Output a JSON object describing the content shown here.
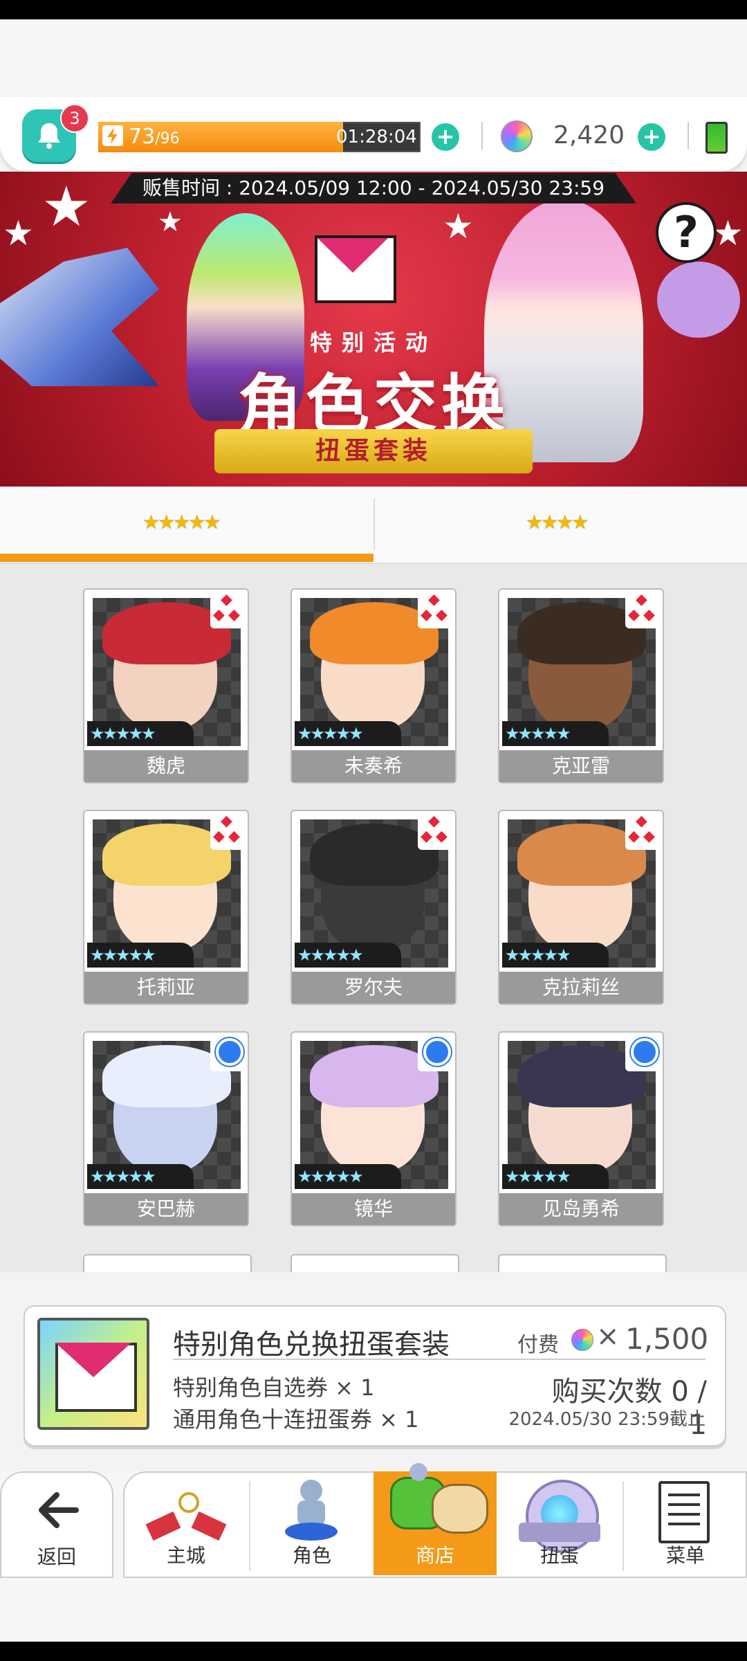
{
  "hud": {
    "notification_count": "3",
    "stamina_current": "73",
    "stamina_max": "/96",
    "stamina_fraction": 0.76,
    "stamina_timer": "01:28:04",
    "gems": "2,420"
  },
  "banner": {
    "sale_time": "贩售时间 : 2024.05/09 12:00 - 2024.05/30 23:59",
    "tag": "特别活动",
    "title": "角色交换",
    "subtitle": "扭蛋套装",
    "help_glyph": "?"
  },
  "tabs": [
    {
      "label": "★★★★★",
      "active": true
    },
    {
      "label": "★★★★",
      "active": false
    }
  ],
  "characters": [
    {
      "name": "魏虎",
      "stars": "★★★★★",
      "rank_icon": "diamond-icon"
    },
    {
      "name": "未奏希",
      "stars": "★★★★★",
      "rank_icon": "diamond-icon"
    },
    {
      "name": "克亚雷",
      "stars": "★★★★★",
      "rank_icon": "diamond-icon"
    },
    {
      "name": "托莉亚",
      "stars": "★★★★★",
      "rank_icon": "diamond-icon"
    },
    {
      "name": "罗尔夫",
      "stars": "★★★★★",
      "rank_icon": "diamond-icon"
    },
    {
      "name": "克拉莉丝",
      "stars": "★★★★★",
      "rank_icon": "diamond-icon"
    },
    {
      "name": "安巴赫",
      "stars": "★★★★★",
      "rank_icon": "circle-icon"
    },
    {
      "name": "镜华",
      "stars": "★★★★★",
      "rank_icon": "circle-icon"
    },
    {
      "name": "见岛勇希",
      "stars": "★★★★★",
      "rank_icon": "circle-icon"
    }
  ],
  "product": {
    "title": "特别角色兑换扭蛋套装",
    "item1": "特别角色自选券 × 1",
    "item2": "通用角色十连扭蛋券 × 1",
    "price_label": "付费",
    "price_x": "×",
    "price": "1,500",
    "purchase_count": "购买次数 0 / 1",
    "deadline": "2024.05/30 23:59截止"
  },
  "nav": {
    "back": "返回",
    "items": [
      "主城",
      "角色",
      "商店",
      "扭蛋",
      "菜单"
    ],
    "active": "商店"
  }
}
